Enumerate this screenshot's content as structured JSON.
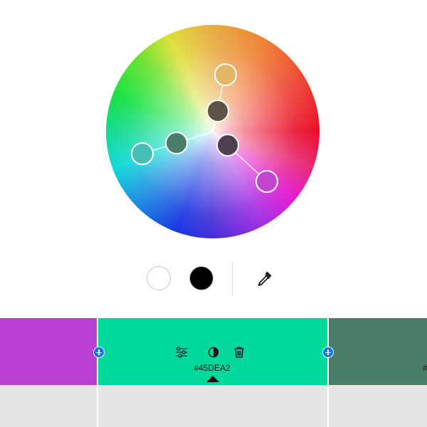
{
  "wheel": {
    "base_handle_color": "#4a7c6a",
    "handles": [
      {
        "name": "yellow",
        "color": "#e3b766"
      },
      {
        "name": "dark-brown",
        "color": "#5c5446"
      },
      {
        "name": "green",
        "color": "#4a7c6a"
      },
      {
        "name": "purple-dark",
        "color": "#4e4050"
      },
      {
        "name": "cyan",
        "color": "#48bfb6"
      },
      {
        "name": "magenta",
        "color": "#c244d0"
      }
    ]
  },
  "controls": {
    "white_color": "#ffffff",
    "black_color": "#000000",
    "eyedropper_icon": "eyedropper-icon"
  },
  "palette": {
    "swatches": [
      {
        "color": "#b93fd3",
        "hex": ""
      },
      {
        "color": "#00d89c",
        "hex": "#45DEA2",
        "active": true
      },
      {
        "color": "#4a7c6a",
        "hex": "#"
      }
    ],
    "tools": [
      "sliders-icon",
      "contrast-icon",
      "trash-icon"
    ],
    "add_icon": "plus-icon",
    "accent": "#1473e6"
  }
}
